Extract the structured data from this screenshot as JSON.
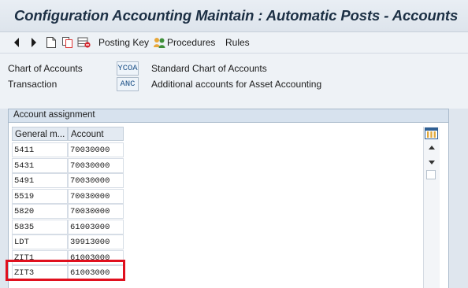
{
  "window": {
    "title": "Configuration Accounting Maintain : Automatic Posts - Accounts"
  },
  "toolbar": {
    "icons": [
      "arrow-left-icon",
      "arrow-right-icon",
      "new-document-icon",
      "copy-icon",
      "delete-icon"
    ],
    "posting_key_label": "Posting Key",
    "procedures_label": "Procedures",
    "rules_label": "Rules"
  },
  "header": {
    "chart_of_accounts_label": "Chart of Accounts",
    "chart_of_accounts_value": "YCOA",
    "chart_of_accounts_desc": "Standard Chart of Accounts",
    "transaction_label": "Transaction",
    "transaction_value": "ANC",
    "transaction_desc": "Additional accounts for Asset Accounting"
  },
  "account_assignment": {
    "title": "Account assignment",
    "columns": [
      "General m...",
      "Account"
    ],
    "rows": [
      [
        "5411",
        "70030000"
      ],
      [
        "5431",
        "70030000"
      ],
      [
        "5491",
        "70030000"
      ],
      [
        "5519",
        "70030000"
      ],
      [
        "5820",
        "70030000"
      ],
      [
        "5835",
        "61003000"
      ],
      [
        "LDT",
        "39913000"
      ],
      [
        "ZIT1",
        "61003000"
      ],
      [
        "ZIT3",
        "61003000"
      ]
    ]
  },
  "colors": {
    "highlight": "#e0101e",
    "title": "#1c2f44",
    "panel_header": "#d7e2ee"
  }
}
